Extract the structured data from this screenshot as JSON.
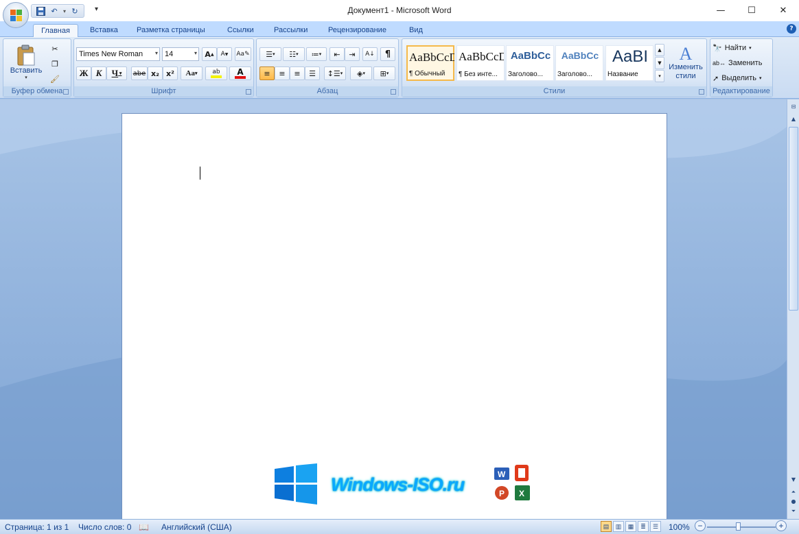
{
  "window": {
    "title": "Документ1 - Microsoft Word",
    "controls": {
      "minimize": "—",
      "maximize": "☐",
      "close": "✕"
    }
  },
  "qat": {
    "save": "💾",
    "undo": "↶",
    "redo": "↻",
    "more": "▾"
  },
  "tabs": [
    {
      "label": "Главная",
      "active": true
    },
    {
      "label": "Вставка"
    },
    {
      "label": "Разметка страницы"
    },
    {
      "label": "Ссылки"
    },
    {
      "label": "Рассылки"
    },
    {
      "label": "Рецензирование"
    },
    {
      "label": "Вид"
    }
  ],
  "help": "?",
  "ribbon": {
    "clipboard": {
      "label": "Буфер обмена",
      "paste": "Вставить"
    },
    "font": {
      "label": "Шрифт",
      "font_name": "Times New Roman",
      "font_size": "14",
      "grow": "A",
      "shrink": "A",
      "bold": "Ж",
      "italic": "К",
      "underline": "Ч",
      "strike": "abe",
      "subscript": "x₂",
      "superscript": "x²",
      "case": "Aa",
      "highlight": "ab",
      "color": "A"
    },
    "paragraph": {
      "label": "Абзац",
      "pilcrow": "¶"
    },
    "styles": {
      "label": "Стили",
      "change": "Изменить стили",
      "items": [
        {
          "sample": "AaBbCcDc",
          "name": "¶ Обычный",
          "selected": true,
          "color": "#111111"
        },
        {
          "sample": "AaBbCcDc",
          "name": "¶ Без инте...",
          "color": "#111111"
        },
        {
          "sample": "AaBbCc",
          "name": "Заголово...",
          "color": "#2e5e9a"
        },
        {
          "sample": "AaBbCc",
          "name": "Заголово...",
          "color": "#4f81bd"
        },
        {
          "sample": "AaBI",
          "name": "Название",
          "color": "#17365d"
        }
      ]
    },
    "editing": {
      "label": "Редактирование",
      "find": "Найти",
      "replace": "Заменить",
      "select": "Выделить"
    }
  },
  "watermark": {
    "text": "Windows-ISO.ru"
  },
  "statusbar": {
    "page": "Страница: 1 из 1",
    "words": "Число слов: 0",
    "language": "Английский (США)",
    "zoom": "100%",
    "zoom_out": "−",
    "zoom_in": "+"
  }
}
